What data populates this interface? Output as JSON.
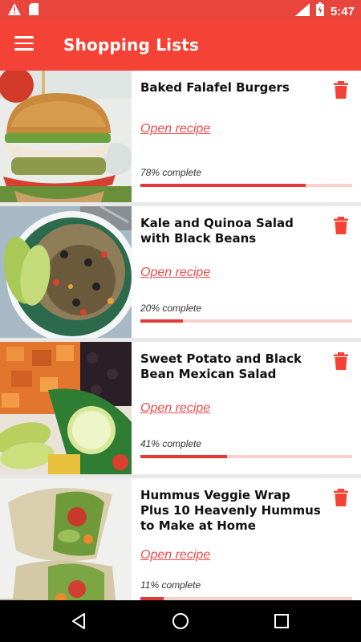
{
  "status": {
    "time": "5:47",
    "network": "LTE"
  },
  "app_bar": {
    "title": "Shopping Lists"
  },
  "recipes": [
    {
      "title": "Baked Falafel Burgers",
      "link": "Open recipe",
      "progress_text": "78% complete",
      "progress": 0.78
    },
    {
      "title": "Kale and Quinoa Salad with Black Beans",
      "link": "Open recipe",
      "progress_text": "20% complete",
      "progress": 0.2
    },
    {
      "title": "Sweet Potato and Black Bean Mexican Salad",
      "link": "Open recipe",
      "progress_text": "41% complete",
      "progress": 0.41
    },
    {
      "title": "Hummus Veggie Wrap Plus 10 Heavenly Hummus to Make at Home",
      "link": "Open recipe",
      "progress_text": "11% complete",
      "progress": 0.11
    }
  ],
  "colors": {
    "primary": "#f44336",
    "status_bar": "#e8453c",
    "accent": "#e53935"
  }
}
